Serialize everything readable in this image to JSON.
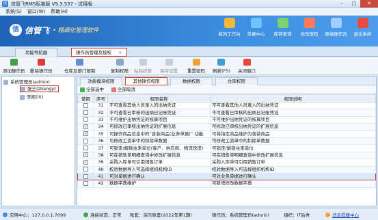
{
  "window": {
    "title": "信管飞RMS标准版 V9.3.537 - 试用版",
    "controls": [
      "–",
      "□",
      "✕"
    ]
  },
  "menu": [
    "系统(S)",
    "窗口(W)",
    "帮助(H)"
  ],
  "banner": {
    "logo_char": "信",
    "brand": "信管飞",
    "slogan": "• 精细化管理软件"
  },
  "topnav": [
    {
      "label": "我的工作台",
      "color": "#f4b63b"
    },
    {
      "label": "单据中心",
      "color": "#6fc3ff"
    },
    {
      "label": "库存查询",
      "color": "#7bd36f"
    },
    {
      "label": "修改密码",
      "color": "#ff7a59"
    },
    {
      "label": "更换操作员",
      "color": "#9fd0ff"
    },
    {
      "label": "退出系统",
      "color": "#e84b3c"
    }
  ],
  "doc_tabs": [
    {
      "label": "功能导航器"
    },
    {
      "label": "操作员管理及授权",
      "close": "×"
    }
  ],
  "toolbar": [
    {
      "label": "添加操作员",
      "color": "#43a047",
      "disabled": false
    },
    {
      "label": "删除操作员",
      "color": "#e53935",
      "disabled": false
    },
    {
      "label": "仓库及部门限制",
      "color": "#5c8fd6",
      "disabled": false
    },
    {
      "label": "复制权限",
      "color": "#8aa7c9",
      "disabled": false
    },
    {
      "label": "粘贴权限",
      "color": "#c3cfdc",
      "disabled": true
    },
    {
      "label": "保存设置",
      "color": "#c3cfdc",
      "disabled": true
    },
    {
      "label": "重置密码",
      "color": "#f0a33b",
      "disabled": false
    },
    {
      "label": "刷新(F5)",
      "color": "#3f9ed6",
      "disabled": false
    },
    {
      "label": "关闭窗口",
      "color": "#e0483a",
      "disabled": false
    }
  ],
  "tree": [
    {
      "label": "系统管理员(admin)",
      "selected": false
    },
    {
      "label": "张三(zhangy)",
      "selected": true
    },
    {
      "label": "李拓(lit)",
      "selected": false
    }
  ],
  "sub_tabs": [
    "功能模块权限",
    "其他操作权限",
    "数据权限",
    "仓库权限"
  ],
  "select_bar": {
    "select_all": "全部选中",
    "cancel_all": "全部取消"
  },
  "grid": {
    "headers": [
      "使用",
      "序号",
      "权限名称",
      "权限说明"
    ],
    "rows": [
      {
        "use": false,
        "no": "31",
        "name": "不可查看其他人员录入的出纳凭证",
        "desc": "不可查看其他人员录入的出纳凭证"
      },
      {
        "use": false,
        "no": "32",
        "name": "不可查看已审核的出纳日记账凭证",
        "desc": "不可查看已审核的出纳日记账凭证"
      },
      {
        "use": false,
        "no": "33",
        "name": "不可维护出纳凭证的核算项目",
        "desc": "不可维护出纳凭证的核算项目"
      },
      {
        "use": true,
        "no": "34",
        "name": "可修改已审核出纳凭证的扩展信息",
        "desc": "可修改已审核出纳凭证的扩展信息"
      },
      {
        "use": true,
        "no": "35",
        "name": "可操作商品信息中的“普装商品(业务单据)” 功能",
        "desc": "可将指定商品维护为普装商品"
      },
      {
        "use": false,
        "no": "36",
        "name": "可修改工资单中的扣除单数据",
        "desc": "可修改工资单中的扣除单数据"
      },
      {
        "use": false,
        "no": "37",
        "name": "可锁定/解锁往来单位(客户、供应商、物流快递)",
        "desc": "可锁定/解锁往来单位"
      },
      {
        "use": true,
        "no": "38",
        "name": "可在销售单明细查询中修改扩展信息",
        "desc": "可在销售单明细查询中修改扩展信息"
      },
      {
        "use": true,
        "no": "39",
        "name": "采购入库单可引用销售订单",
        "desc": "采购入库单可引用销售订单"
      },
      {
        "use": false,
        "no": "40",
        "name": "权验数据导入可选择组织机构ID",
        "desc": "权验数据导入可选择组织机构ID"
      },
      {
        "use": false,
        "no": "41",
        "name": "可对单据进行确认",
        "desc": "可对业务单据进行确认",
        "highlight": true
      },
      {
        "use": false,
        "no": "42",
        "name": "数据字典维护",
        "desc": "可新增修改数据字典"
      }
    ]
  },
  "status": {
    "app_center": "应用中心：127.0.0.1:7099",
    "connection": "连接状态：正常",
    "account": "账套：演示账套(2022年第1期)",
    "operator": "操作员：系统管理员(admin)",
    "org": "组织：IT后舍",
    "msg_link": "消息提醒中心"
  }
}
